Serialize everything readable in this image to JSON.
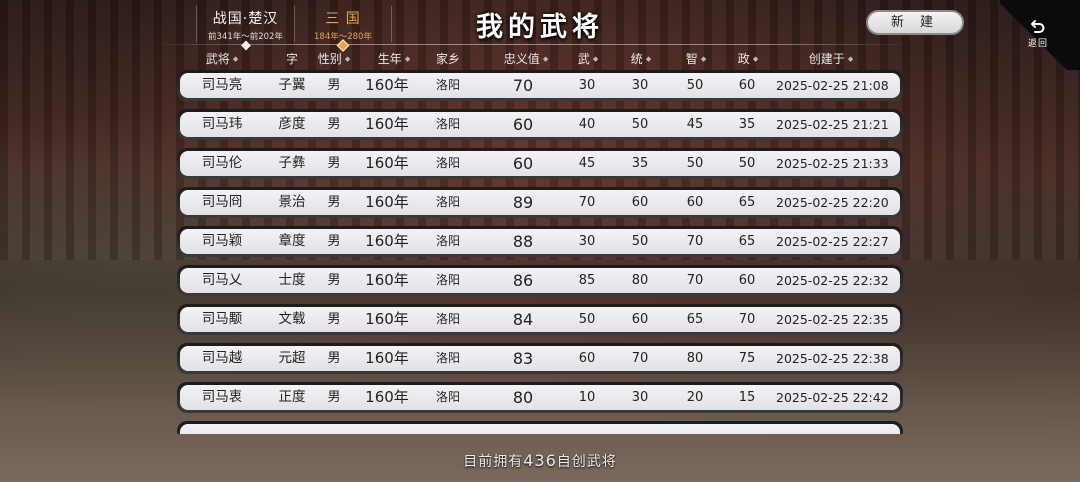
{
  "era_tabs": [
    {
      "name": "战国·楚汉",
      "range": "前341年～前202年",
      "active": false
    },
    {
      "name": "三 国",
      "range": "184年～280年",
      "active": true
    }
  ],
  "page": {
    "title": "我的武将",
    "new_button_label": "新 建",
    "back_label": "返回",
    "footer_prefix": "目前拥有",
    "footer_count": "436",
    "footer_suffix": "自创武将"
  },
  "columns": {
    "name": "武将",
    "zi": "字",
    "sex": "性别",
    "birth": "生年",
    "home": "家乡",
    "loyalty": "忠义值",
    "wu": "武",
    "tong": "统",
    "zhi": "智",
    "zheng": "政",
    "created": "创建于"
  },
  "generals": [
    {
      "name": "司马亮",
      "zi": "子翼",
      "sex": "男",
      "birth": "160年",
      "home": "洛阳",
      "loyalty": "70",
      "wu": "30",
      "tong": "30",
      "zhi": "50",
      "zheng": "60",
      "created": "2025-02-25 21:08"
    },
    {
      "name": "司马玮",
      "zi": "彦度",
      "sex": "男",
      "birth": "160年",
      "home": "洛阳",
      "loyalty": "60",
      "wu": "40",
      "tong": "50",
      "zhi": "45",
      "zheng": "35",
      "created": "2025-02-25 21:21"
    },
    {
      "name": "司马伦",
      "zi": "子彝",
      "sex": "男",
      "birth": "160年",
      "home": "洛阳",
      "loyalty": "60",
      "wu": "45",
      "tong": "35",
      "zhi": "50",
      "zheng": "50",
      "created": "2025-02-25 21:33"
    },
    {
      "name": "司马冏",
      "zi": "景治",
      "sex": "男",
      "birth": "160年",
      "home": "洛阳",
      "loyalty": "89",
      "wu": "70",
      "tong": "60",
      "zhi": "60",
      "zheng": "65",
      "created": "2025-02-25 22:20"
    },
    {
      "name": "司马颖",
      "zi": "章度",
      "sex": "男",
      "birth": "160年",
      "home": "洛阳",
      "loyalty": "88",
      "wu": "30",
      "tong": "50",
      "zhi": "70",
      "zheng": "65",
      "created": "2025-02-25 22:27"
    },
    {
      "name": "司马乂",
      "zi": "士度",
      "sex": "男",
      "birth": "160年",
      "home": "洛阳",
      "loyalty": "86",
      "wu": "85",
      "tong": "80",
      "zhi": "70",
      "zheng": "60",
      "created": "2025-02-25 22:32"
    },
    {
      "name": "司马颙",
      "zi": "文载",
      "sex": "男",
      "birth": "160年",
      "home": "洛阳",
      "loyalty": "84",
      "wu": "50",
      "tong": "60",
      "zhi": "65",
      "zheng": "70",
      "created": "2025-02-25 22:35"
    },
    {
      "name": "司马越",
      "zi": "元超",
      "sex": "男",
      "birth": "160年",
      "home": "洛阳",
      "loyalty": "83",
      "wu": "60",
      "tong": "70",
      "zhi": "80",
      "zheng": "75",
      "created": "2025-02-25 22:38"
    },
    {
      "name": "司马衷",
      "zi": "正度",
      "sex": "男",
      "birth": "160年",
      "home": "洛阳",
      "loyalty": "80",
      "wu": "10",
      "tong": "30",
      "zhi": "20",
      "zheng": "15",
      "created": "2025-02-25 22:42"
    }
  ],
  "icons": {
    "back": "back-arrow-icon",
    "sort": "sort-diamond-icon"
  },
  "colors": {
    "accent": "#e8a64a",
    "row_bg": "#e8e7ec"
  }
}
